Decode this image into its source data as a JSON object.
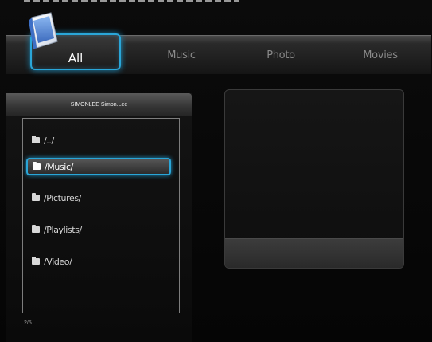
{
  "tabs": {
    "all": "All",
    "music": "Music",
    "photo": "Photo",
    "movies": "Movies"
  },
  "panel": {
    "header": "SIMONLEE Simon.Lee"
  },
  "folders": [
    {
      "label": "/../"
    },
    {
      "label": "/Music/",
      "selected": true
    },
    {
      "label": "/Pictures/"
    },
    {
      "label": "/Playlists/"
    },
    {
      "label": "/Video/"
    }
  ],
  "pager": "2/5",
  "colors": {
    "accent": "#2aa6d8",
    "background": "#0b0b0b"
  },
  "icons": {
    "logo": "media-library-logo-icon",
    "folder": "folder-icon"
  }
}
